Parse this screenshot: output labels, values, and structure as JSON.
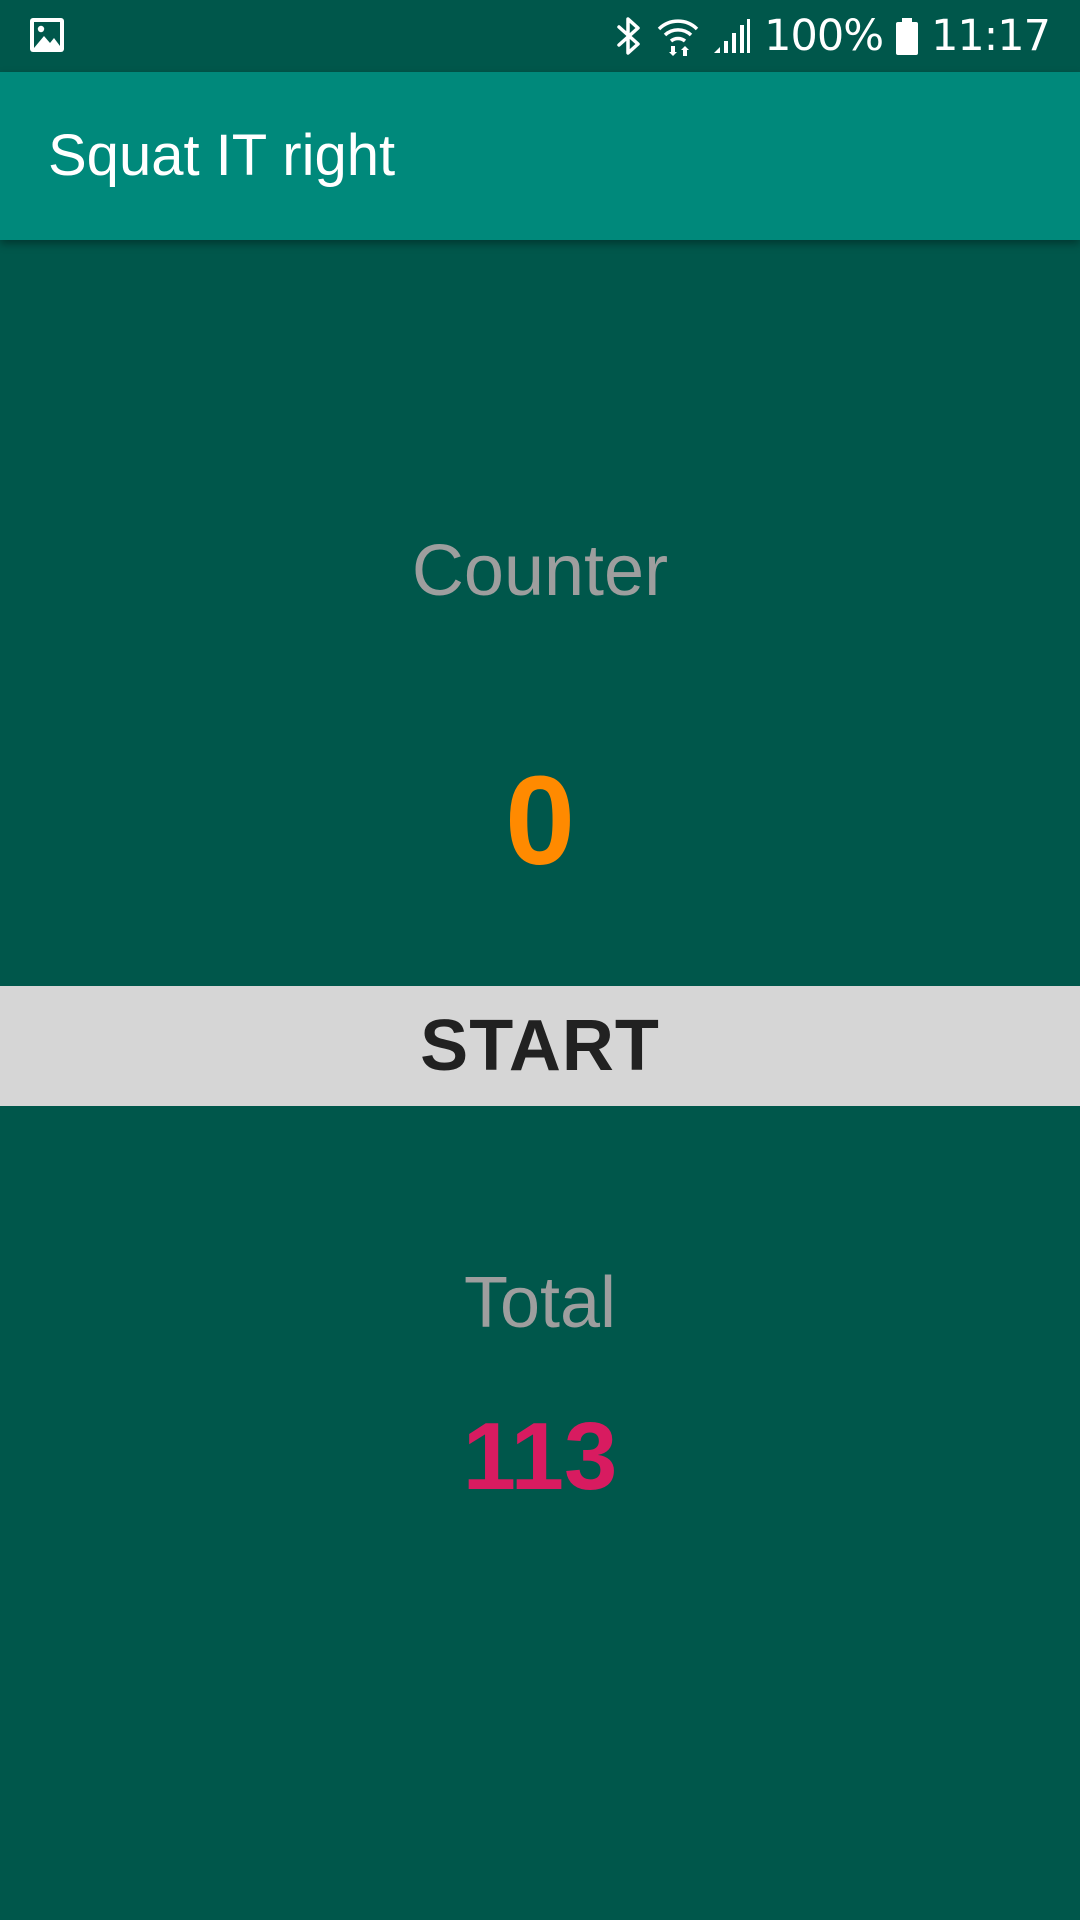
{
  "status_bar": {
    "left_icon": "image-notification-icon",
    "icons": [
      "bluetooth-icon",
      "wifi-icon",
      "signal-icon",
      "battery-icon"
    ],
    "battery": "100%",
    "time": "11:17"
  },
  "app_bar": {
    "title": "Squat IT right"
  },
  "counter": {
    "label": "Counter",
    "value": "0"
  },
  "start_button": {
    "label": "START"
  },
  "total": {
    "label": "Total",
    "value": "113"
  },
  "colors": {
    "background": "#00574b",
    "app_bar": "#00897b",
    "counter_value": "#ff8a00",
    "total_value": "#d81b60",
    "label_text": "#9e9e9e",
    "button_background": "#d6d6d6",
    "button_text": "#212121"
  }
}
